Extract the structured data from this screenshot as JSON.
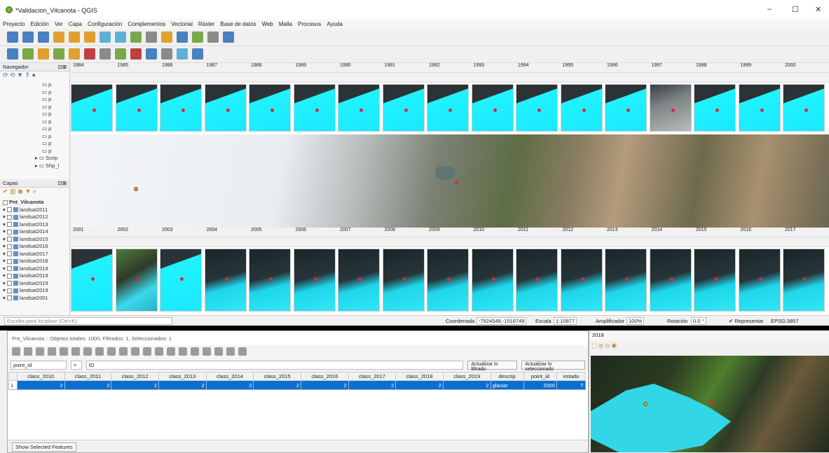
{
  "window": {
    "title": "*Validacion_Vilcanota - QGIS",
    "controls": [
      "–",
      "☐",
      "✕"
    ]
  },
  "menu": [
    "Proyecto",
    "Edición",
    "Ver",
    "Capa",
    "Configuración",
    "Complementos",
    "Vectorial",
    "Ráster",
    "Base de datos",
    "Web",
    "Malla",
    "Procesos",
    "Ayuda"
  ],
  "browser": {
    "title": "Navegador",
    "items": [
      "p",
      "p",
      "p",
      "p",
      "p",
      "p",
      "p",
      "p",
      "p",
      "p",
      "Scrip",
      "Shp_l"
    ]
  },
  "layers": {
    "title": "Capas",
    "items": [
      "Pnt_Vilcanota",
      "landsat2011",
      "landsat2012",
      "landsat2013",
      "landsat2014",
      "landsat2015",
      "landsat2016",
      "landsat2017",
      "landsat2018",
      "landsat2019",
      "landsat2019",
      "landsat2019",
      "landsat2019",
      "landsat2001"
    ]
  },
  "years_top": [
    "1984",
    "1985",
    "1986",
    "1987",
    "1988",
    "1989",
    "1990",
    "1991",
    "1992",
    "1993",
    "1994",
    "1995",
    "1996",
    "1997",
    "1998",
    "1999",
    "2000"
  ],
  "years_bottom": [
    "2001",
    "2002",
    "2003",
    "2004",
    "2005",
    "2006",
    "2007",
    "2008",
    "2009",
    "2010",
    "2011",
    "2012",
    "2013",
    "2014",
    "2015",
    "2016",
    "2017"
  ],
  "status": {
    "locator": "Escriba para localizar (Ctrl+K)",
    "coord_label": "Coordenada",
    "coord": "-7924549,-1518749",
    "scale_label": "Escala",
    "scale": "1:10877",
    "mag_label": "Amplificador",
    "mag": "100%",
    "rot_label": "Rotación",
    "rot": "0.0 °",
    "render": "Representar",
    "crs": "EPSG:3857"
  },
  "attr": {
    "title": "Pnt_Vilcanota :: Objetos totales: 1000, Filtrados: 1, Seleccionados: 1",
    "field": "point_id",
    "eq": "=",
    "expr": "ID",
    "update_filtered": "Actualizar lo filtrado",
    "update_selected": "Actualizar lo seleccionado",
    "columns": [
      "class_2010",
      "class_2011",
      "class_2012",
      "class_2013",
      "class_2014",
      "class_2015",
      "class_2016",
      "class_2017",
      "class_2018",
      "class_2019",
      "descrip",
      "point_id",
      "estado"
    ],
    "row_num": "1",
    "row": [
      "2",
      "2",
      "2",
      "2",
      "2",
      "2",
      "2",
      "2",
      "2",
      "2",
      "glaciar",
      "2000",
      "T"
    ],
    "footer": "Show Selected Features"
  },
  "inset": {
    "year": "2018"
  }
}
